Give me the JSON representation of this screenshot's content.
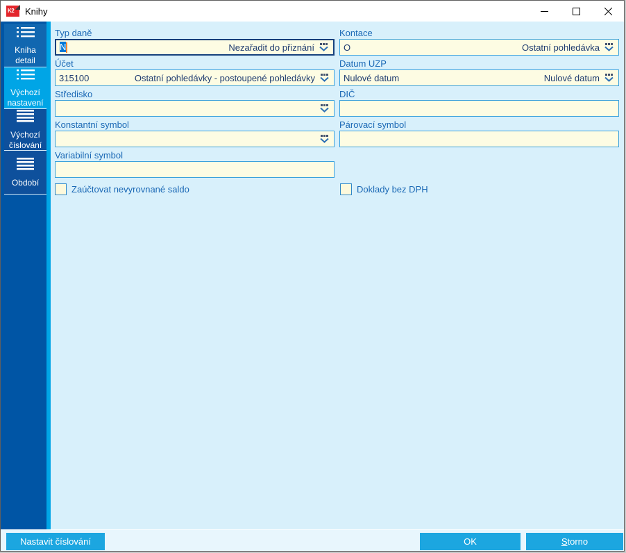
{
  "window": {
    "title": "Knihy",
    "logo_text": "K2"
  },
  "colors": {
    "accent_cyan": "#00a5e6",
    "sidebar_rail": "#0055a5",
    "sidebar_item": "#1167b0",
    "sidebar_item_dark": "#0e509c",
    "content_bg": "#d8f0fb",
    "field_bg": "#fdfce3",
    "field_border": "#3ba1dc",
    "focus_border": "#16407c",
    "label_blue": "#1a68b5",
    "value_navy": "#1f3c70",
    "button_cyan": "#1ca6e0",
    "selection_blue": "#0078d7",
    "caret_orange": "#ef8633",
    "logo_red": "#e3252b"
  },
  "sidebar": {
    "items": [
      {
        "label": "Kniha detail",
        "active": false
      },
      {
        "label": "Výchozí nastavení",
        "active": true
      },
      {
        "label": "Výchozí číslování",
        "active": false
      },
      {
        "label": "Období",
        "active": false
      }
    ]
  },
  "form": {
    "fields": {
      "typ_dane": {
        "label": "Typ daně",
        "value": "N",
        "descriptor": "Nezařadit do přiznání",
        "focused": true
      },
      "kontace": {
        "label": "Kontace",
        "value": "O",
        "descriptor": "Ostatní pohledávka"
      },
      "ucet": {
        "label": "Účet",
        "value": "315100",
        "descriptor": "Ostatní pohledávky - postoupené pohledávky"
      },
      "datum_uzp": {
        "label": "Datum UZP",
        "value": "Nulové datum",
        "descriptor": "Nulové datum"
      },
      "stredisko": {
        "label": "Středisko",
        "value": "",
        "descriptor": ""
      },
      "dic": {
        "label": "DIČ",
        "value": ""
      },
      "konstantni_symbol": {
        "label": "Konstantní symbol",
        "value": "",
        "descriptor": ""
      },
      "parovaci_symbol": {
        "label": "Párovací symbol",
        "value": ""
      },
      "variabilni_symbol": {
        "label": "Variabilní symbol",
        "value": ""
      }
    },
    "checkboxes": {
      "zauctovat": {
        "label": "Zaúčtovat nevyrovnané saldo",
        "checked": false
      },
      "doklady": {
        "label": "Doklady bez DPH",
        "checked": false
      }
    }
  },
  "footer": {
    "nastavit_label": "Nastavit číslování",
    "ok_label": "OK",
    "storno_accel": "S",
    "storno_rest": "torno"
  }
}
